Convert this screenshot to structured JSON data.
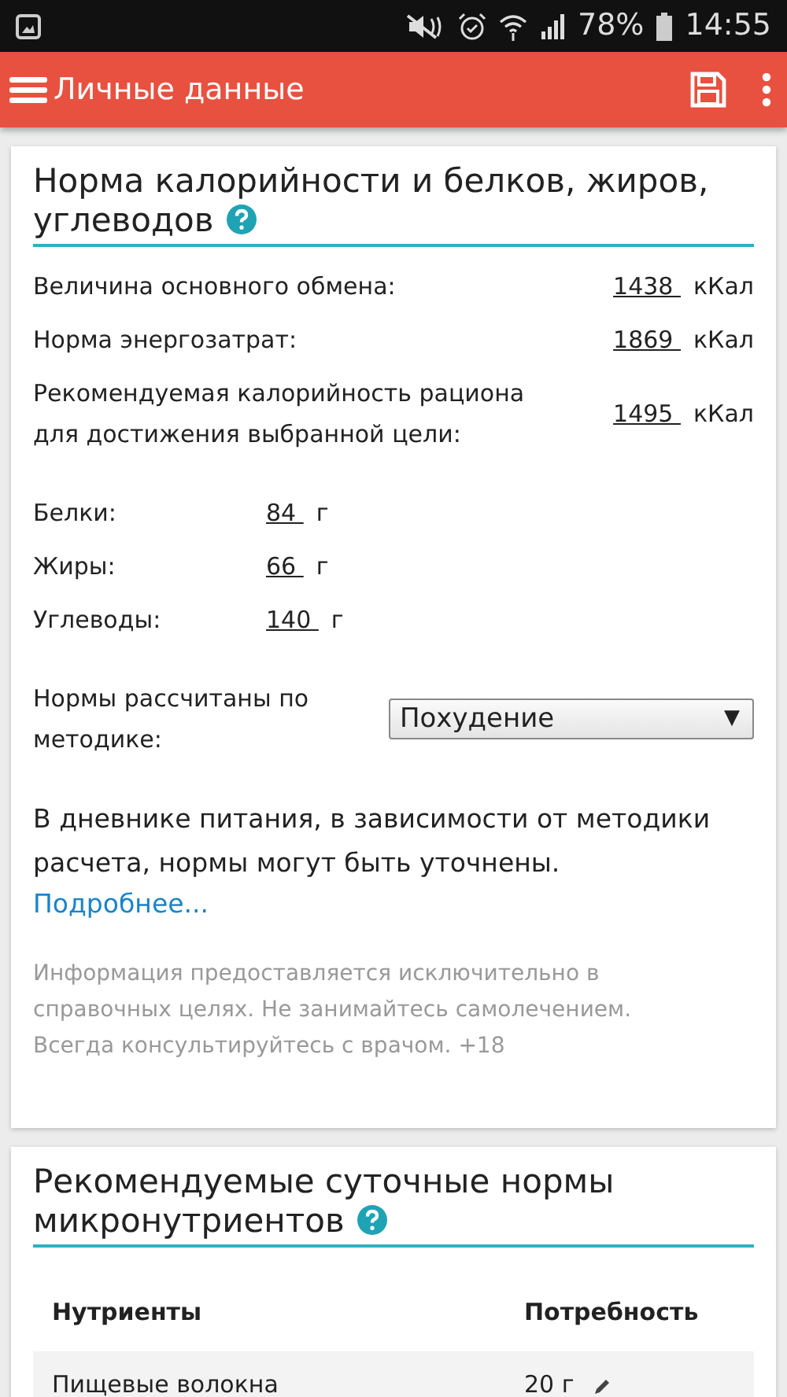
{
  "status_bar": {
    "battery": "78%",
    "time": "14:55"
  },
  "app_bar": {
    "title": "Личные данные"
  },
  "calorie_card": {
    "title_lines": [
      "Норма калорийности и белков, жиров,",
      "углеводов"
    ],
    "energy_rows": [
      {
        "label": "Величина основного обмена:",
        "value": "1438",
        "unit": "кКал"
      },
      {
        "label": "Норма энергозатрат:",
        "value": "1869",
        "unit": "кКал"
      },
      {
        "label": "Рекомендуемая калорийность рациона для достижения выбранной цели:",
        "value": "1495",
        "unit": "кКал"
      }
    ],
    "macro_rows": [
      {
        "label": "Белки:",
        "value": "84",
        "unit": "г"
      },
      {
        "label": "Жиры:",
        "value": "66",
        "unit": "г"
      },
      {
        "label": "Углеводы:",
        "value": "140",
        "unit": "г"
      }
    ],
    "method": {
      "label": "Нормы рассчитаны по методике:",
      "value": "Похудение",
      "arrow": "▼"
    },
    "note": "В дневнике питания, в зависимости от методики расчета, нормы могут быть уточнены.",
    "link": "Подробнее...",
    "disclaimer": "Информация предоставляется исключительно в справочных целях. Не занимайтесь самолечением. Всегда консультируйтесь с врачом. +18"
  },
  "micro_card": {
    "title_lines": [
      "Рекомендуемые суточные нормы",
      "микронутриентов"
    ],
    "columns": [
      "Нутриенты",
      "Потребность"
    ],
    "rows": [
      {
        "nutrient": "Пищевые волокна",
        "amount": "20 г"
      }
    ]
  }
}
